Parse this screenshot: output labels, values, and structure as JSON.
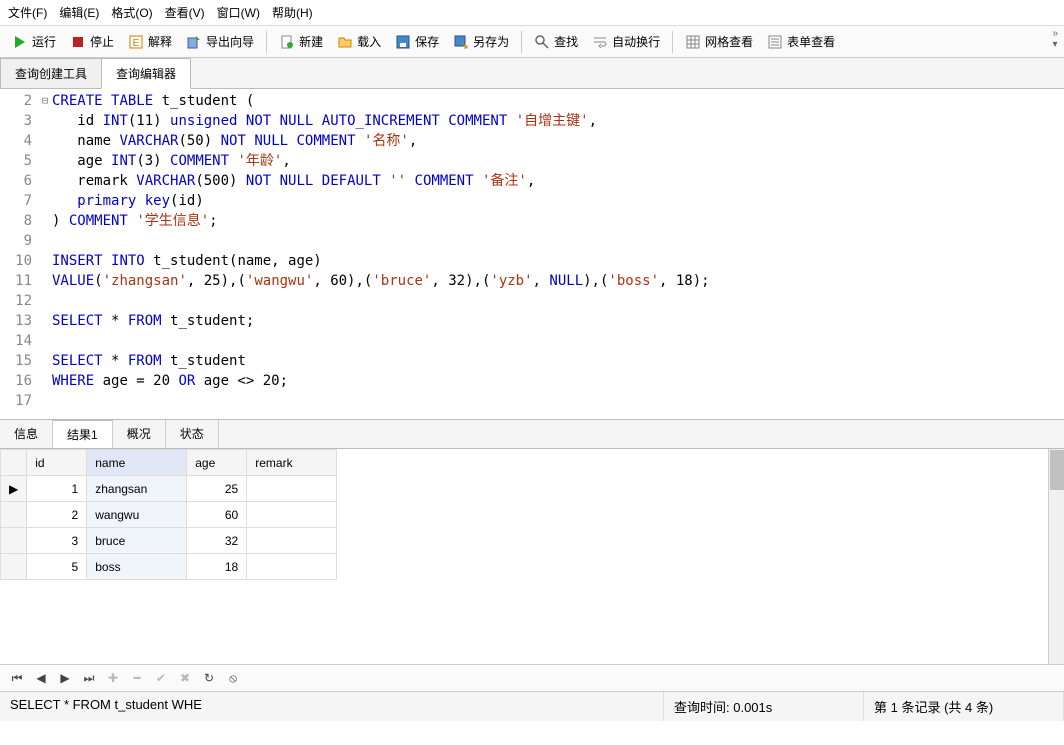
{
  "menubar": [
    "文件(F)",
    "编辑(E)",
    "格式(O)",
    "查看(V)",
    "窗口(W)",
    "帮助(H)"
  ],
  "toolbar": {
    "run": "运行",
    "stop": "停止",
    "explain": "解释",
    "export": "导出向导",
    "new": "新建",
    "load": "载入",
    "save": "保存",
    "saveas": "另存为",
    "find": "查找",
    "wrap": "自动换行",
    "gridview": "网格查看",
    "formview": "表单查看"
  },
  "tabs": {
    "builder": "查询创建工具",
    "editor": "查询编辑器"
  },
  "code_lines": [
    {
      "n": 2,
      "fold": "⊟",
      "html": "<span class='kw'>CREATE</span> <span class='kw'>TABLE</span> t_student ("
    },
    {
      "n": 3,
      "fold": "",
      "html": "   id <span class='kw'>INT</span>(11) <span class='kw'>unsigned</span> <span class='kw'>NOT</span> <span class='kw'>NULL</span> <span class='kw'>AUTO_INCREMENT</span> <span class='kw'>COMMENT</span> <span class='str'>'自增主键'</span>,"
    },
    {
      "n": 4,
      "fold": "",
      "html": "   name <span class='kw'>VARCHAR</span>(50) <span class='kw'>NOT</span> <span class='kw'>NULL</span> <span class='kw'>COMMENT</span> <span class='str'>'名称'</span>,"
    },
    {
      "n": 5,
      "fold": "",
      "html": "   age <span class='kw'>INT</span>(3) <span class='kw'>COMMENT</span> <span class='str'>'年龄'</span>,"
    },
    {
      "n": 6,
      "fold": "",
      "html": "   remark <span class='kw'>VARCHAR</span>(500) <span class='kw'>NOT</span> <span class='kw'>NULL</span> <span class='kw'>DEFAULT</span> <span class='str'>''</span> <span class='kw'>COMMENT</span> <span class='str'>'备注'</span>,"
    },
    {
      "n": 7,
      "fold": "",
      "html": "   <span class='kw'>primary</span> <span class='kw'>key</span>(id)"
    },
    {
      "n": 8,
      "fold": "",
      "html": ") <span class='kw'>COMMENT</span> <span class='str'>'学生信息'</span>;"
    },
    {
      "n": 9,
      "fold": "",
      "html": ""
    },
    {
      "n": 10,
      "fold": "",
      "html": "<span class='kw'>INSERT</span> <span class='kw'>INTO</span> t_student(name, age)"
    },
    {
      "n": 11,
      "fold": "",
      "html": "<span class='kw'>VALUE</span>(<span class='str'>'zhangsan'</span>, 25),(<span class='str'>'wangwu'</span>, 60),(<span class='str'>'bruce'</span>, 32),(<span class='str'>'yzb'</span>, <span class='kw'>NULL</span>),(<span class='str'>'boss'</span>, 18);"
    },
    {
      "n": 12,
      "fold": "",
      "html": ""
    },
    {
      "n": 13,
      "fold": "",
      "html": "<span class='kw'>SELECT</span> * <span class='kw'>FROM</span> t_student;"
    },
    {
      "n": 14,
      "fold": "",
      "html": ""
    },
    {
      "n": 15,
      "fold": "",
      "html": "<span class='kw'>SELECT</span> * <span class='kw'>FROM</span> t_student"
    },
    {
      "n": 16,
      "fold": "",
      "html": "<span class='kw'>WHERE</span> age = 20 <span class='kw'>OR</span> age &lt;&gt; 20;"
    },
    {
      "n": 17,
      "fold": "",
      "html": ""
    }
  ],
  "result_tabs": [
    "信息",
    "结果1",
    "概况",
    "状态"
  ],
  "result_tab_active": 1,
  "grid": {
    "columns": [
      "id",
      "name",
      "age",
      "remark"
    ],
    "sorted_col": 1,
    "rows": [
      {
        "current": true,
        "cells": [
          "1",
          "zhangsan",
          "25",
          ""
        ]
      },
      {
        "current": false,
        "cells": [
          "2",
          "wangwu",
          "60",
          ""
        ]
      },
      {
        "current": false,
        "cells": [
          "3",
          "bruce",
          "32",
          ""
        ]
      },
      {
        "current": false,
        "cells": [
          "5",
          "boss",
          "18",
          ""
        ]
      }
    ]
  },
  "statusbar": {
    "sql": "SELECT * FROM t_student WHE",
    "time": "查询时间: 0.001s",
    "record": "第 1 条记录 (共 4 条)"
  },
  "chart_data": {
    "type": "table",
    "columns": [
      "id",
      "name",
      "age",
      "remark"
    ],
    "rows": [
      [
        1,
        "zhangsan",
        25,
        ""
      ],
      [
        2,
        "wangwu",
        60,
        ""
      ],
      [
        3,
        "bruce",
        32,
        ""
      ],
      [
        5,
        "boss",
        18,
        ""
      ]
    ]
  }
}
